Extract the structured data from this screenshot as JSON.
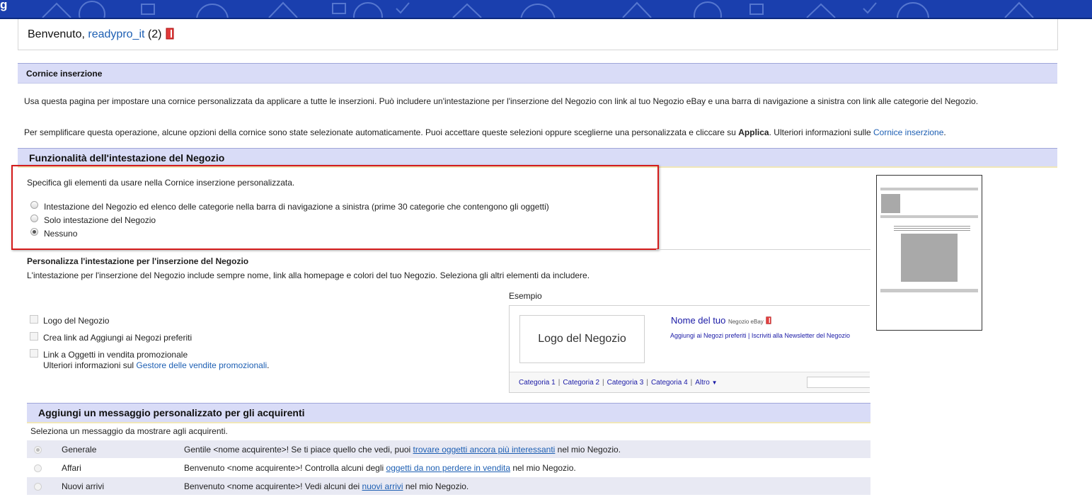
{
  "banner": {
    "brand": "g"
  },
  "welcome": {
    "prefix": "Benvenuto, ",
    "user": "readypro_it",
    "count": "(2)"
  },
  "frame_section": {
    "title": "Cornice inserzione",
    "para1": "Usa questa pagina per impostare una cornice personalizzata da applicare a tutte le inserzioni. Può includere un'intestazione per l'inserzione del Negozio con link al tuo Negozio eBay e una barra di navigazione a sinistra con link alle categorie del Negozio.",
    "para2_pre": "Per semplificare questa operazione, alcune opzioni della cornice sono state selezionate automaticamente. Puoi accettare queste selezioni oppure sceglierne una personalizzata e cliccare su ",
    "para2_bold": "Applica",
    "para2_mid": ". Ulteriori informazioni sulle ",
    "para2_link": "Cornice inserzione",
    "para2_end": "."
  },
  "header_features": {
    "title": "Funzionalità dell'intestazione del Negozio",
    "instruction": "Specifica gli elementi da usare nella Cornice inserzione personalizzata.",
    "options": [
      {
        "label": "Intestazione del Negozio ed elenco delle categorie nella barra di navigazione a sinistra (prime 30 categorie che contengono gli oggetti)",
        "selected": false
      },
      {
        "label": "Solo intestazione del Negozio",
        "selected": false
      },
      {
        "label": "Nessuno",
        "selected": true
      }
    ]
  },
  "customize": {
    "title": "Personalizza l'intestazione per l'inserzione del Negozio",
    "description": "L'intestazione per l'inserzione del Negozio include sempre nome, link alla homepage e colori del tuo Negozio. Seleziona gli altri elementi da includere.",
    "checkboxes": [
      {
        "label": "Logo del Negozio",
        "checked": false
      },
      {
        "label": "Crea link ad Aggiungi ai Negozi preferiti",
        "checked": false
      },
      {
        "label": "Link a Oggetti in vendita promozionale",
        "checked": false
      }
    ],
    "promo_note": "Ulteriori informazioni sul ",
    "promo_link": "Gestore delle vendite promozionali",
    "promo_end": "."
  },
  "example": {
    "label": "Esempio",
    "logo": "Logo del Negozio",
    "store_name": "Nome del tuo",
    "store_suffix": "Negozio eBay",
    "links": "Aggiungi ai Negozi preferiti | Iscriviti alla Newsletter del Negozio",
    "categories": [
      "Categoria 1",
      "Categoria 2",
      "Categoria 3",
      "Categoria 4",
      "Altro"
    ]
  },
  "messages": {
    "title": "Aggiungi un messaggio personalizzato per gli acquirenti",
    "instruction": "Seleziona un messaggio da mostrare agli acquirenti.",
    "rows": [
      {
        "name": "Generale",
        "pre": "Gentile <nome acquirente>! Se ti piace quello che vedi, puoi ",
        "link": "trovare oggetti ancora più interessanti",
        "post": " nel mio Negozio.",
        "selected": true
      },
      {
        "name": "Affari",
        "pre": "Benvenuto <nome acquirente>! Controlla alcuni degli ",
        "link": "oggetti da non perdere in vendita",
        "post": " nel mio Negozio.",
        "selected": false
      },
      {
        "name": "Nuovi arrivi",
        "pre": "Benvenuto <nome acquirente>! Vedi alcuni dei ",
        "link": "nuovi arrivi",
        "post": " nel mio Negozio.",
        "selected": false
      }
    ]
  },
  "colors": {
    "banner": "#1a3fae",
    "section_bar": "#d9dcf7",
    "link": "#1d5fb3",
    "highlight_border": "#d41b1b"
  }
}
